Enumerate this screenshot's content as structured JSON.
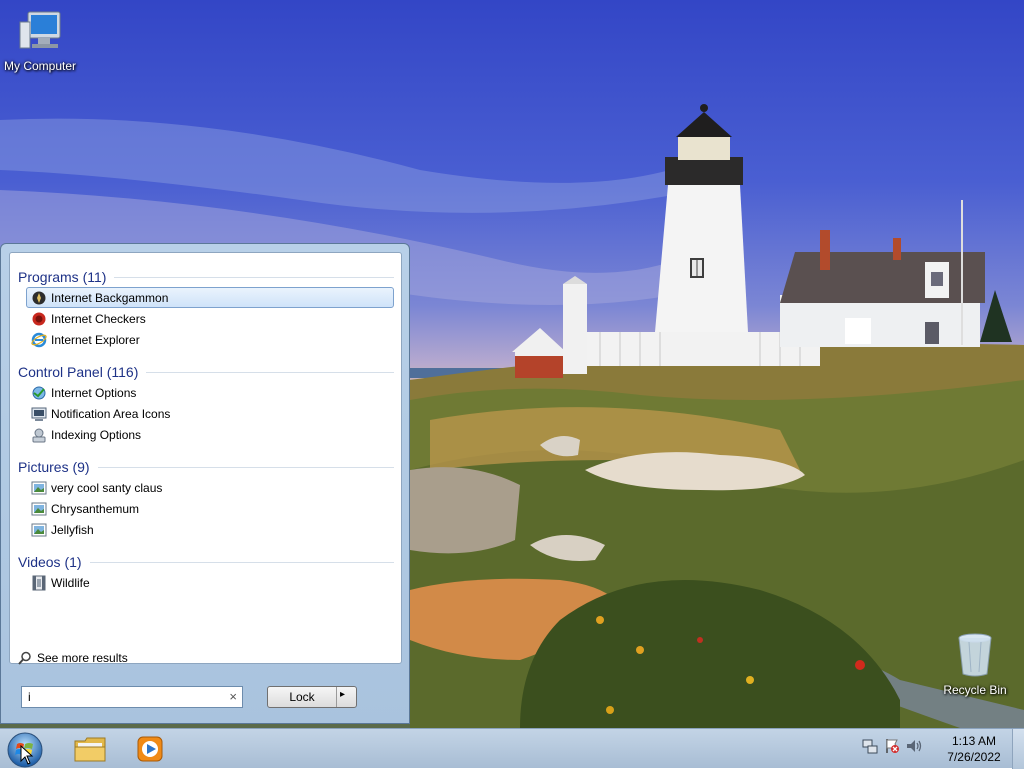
{
  "desktop": {
    "icons": [
      {
        "label": "My Computer",
        "icon": "computer-icon"
      },
      {
        "label": "Recycle Bin",
        "icon": "recycle-bin-icon"
      }
    ]
  },
  "start_menu": {
    "groups": [
      {
        "header": "Programs (11)",
        "items": [
          {
            "label": "Internet Backgammon",
            "icon": "backgammon-icon",
            "selected": true
          },
          {
            "label": "Internet Checkers",
            "icon": "checkers-icon"
          },
          {
            "label": "Internet Explorer",
            "icon": "internet-explorer-icon"
          }
        ]
      },
      {
        "header": "Control Panel (116)",
        "items": [
          {
            "label": "Internet Options",
            "icon": "internet-options-icon"
          },
          {
            "label": "Notification Area Icons",
            "icon": "notification-area-icon"
          },
          {
            "label": "Indexing Options",
            "icon": "indexing-options-icon"
          }
        ]
      },
      {
        "header": "Pictures (9)",
        "items": [
          {
            "label": "very cool santy claus",
            "icon": "picture-icon"
          },
          {
            "label": "Chrysanthemum",
            "icon": "picture-icon"
          },
          {
            "label": "Jellyfish",
            "icon": "picture-icon"
          }
        ]
      },
      {
        "header": "Videos (1)",
        "items": [
          {
            "label": "Wildlife",
            "icon": "video-icon"
          }
        ]
      }
    ],
    "see_more": "See more results",
    "search": {
      "value": "i",
      "clear_glyph": "×"
    },
    "power_button": {
      "label": "Lock",
      "arrow": "▸"
    }
  },
  "taskbar": {
    "pinned": [
      {
        "name": "windows-explorer",
        "icon": "folder-icon"
      },
      {
        "name": "windows-media-player",
        "icon": "media-player-icon"
      }
    ],
    "tray": [
      "network-icon",
      "action-center-flag-icon",
      "volume-icon"
    ],
    "clock": {
      "time": "1:13 AM",
      "date": "7/26/2022"
    }
  },
  "colors": {
    "group_header": "#1e3287",
    "selection": "#cfe3f9",
    "taskbar": "#b3c6da"
  }
}
